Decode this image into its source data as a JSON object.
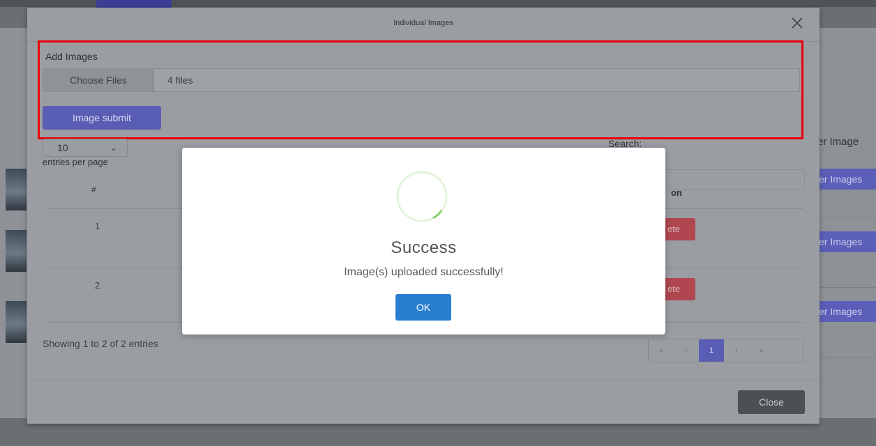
{
  "background": {
    "right_label": "er Image",
    "right_buttons": [
      "er Images",
      "er Images",
      "er Images"
    ]
  },
  "modal": {
    "title": "Individual Images",
    "add_images_label": "Add Images",
    "choose_files_label": "Choose Files",
    "file_count": "4 files",
    "submit_label": "Image submit",
    "length_value": "10",
    "entries_label": "entries per page",
    "search_label": "Search:",
    "column_hash": "#",
    "column_action_partial": "on",
    "rows": [
      {
        "num": "1",
        "delete_partial": "ete"
      },
      {
        "num": "2",
        "delete_partial": "ete"
      }
    ],
    "info_text": "Showing 1 to 2 of 2 entries",
    "pager": [
      "«",
      "‹",
      "1",
      "›",
      "»"
    ],
    "current_page": "1",
    "close_label": "Close"
  },
  "popup": {
    "title": "Success",
    "message": "Image(s) uploaded successfully!",
    "ok_label": "OK"
  },
  "colors": {
    "highlight_border": "#e8000a",
    "primary": "#5a5db4",
    "ok": "#2a7ed0",
    "danger": "#b04650"
  }
}
